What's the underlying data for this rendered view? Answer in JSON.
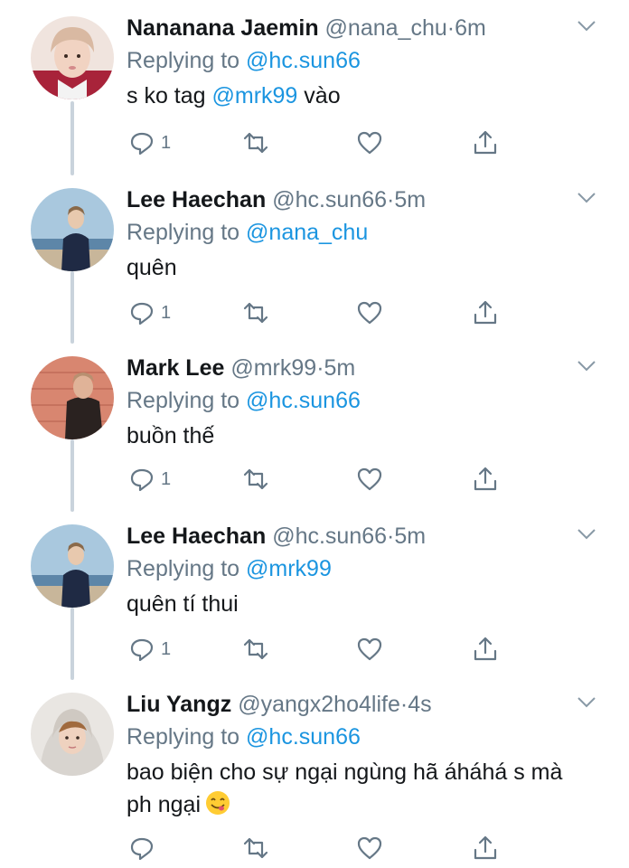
{
  "tweets": [
    {
      "name": "Nananana Jaemin",
      "handle": "@nana_chu",
      "time": "6m",
      "reply_prefix": "Replying to",
      "reply_to": "@hc.sun66",
      "text_before": "s ko tag ",
      "mention": "@mrk99",
      "text_after": " vào",
      "reply_count": "1"
    },
    {
      "name": "Lee Haechan",
      "handle": "@hc.sun66",
      "time": "5m",
      "reply_prefix": "Replying to",
      "reply_to": "@nana_chu",
      "text": "quên",
      "reply_count": "1"
    },
    {
      "name": "Mark Lee",
      "handle": "@mrk99",
      "time": "5m",
      "reply_prefix": "Replying to",
      "reply_to": "@hc.sun66",
      "text": "buồn thế",
      "reply_count": "1"
    },
    {
      "name": "Lee Haechan",
      "handle": "@hc.sun66",
      "time": "5m",
      "reply_prefix": "Replying to",
      "reply_to": "@mrk99",
      "text": "quên tí thui",
      "reply_count": "1"
    },
    {
      "name": "Liu Yangz",
      "handle": "@yangx2ho4life",
      "time": "4s",
      "reply_prefix": "Replying to",
      "reply_to": "@hc.sun66",
      "text_line1": "bao biện cho sự ngại ngùng hã áháhá s mà",
      "text_line2": "ph ngại",
      "reply_count": ""
    }
  ],
  "separator": "·",
  "icons": {
    "reply": "reply-icon",
    "retweet": "retweet-icon",
    "like": "heart-icon",
    "share": "share-icon",
    "more": "chevron-down-icon",
    "emoji": "face-savoring-food-emoji"
  },
  "colors": {
    "name": "#14171a",
    "secondary": "#657786",
    "link": "#1b95e0",
    "thread_line": "#c9d3dc"
  }
}
